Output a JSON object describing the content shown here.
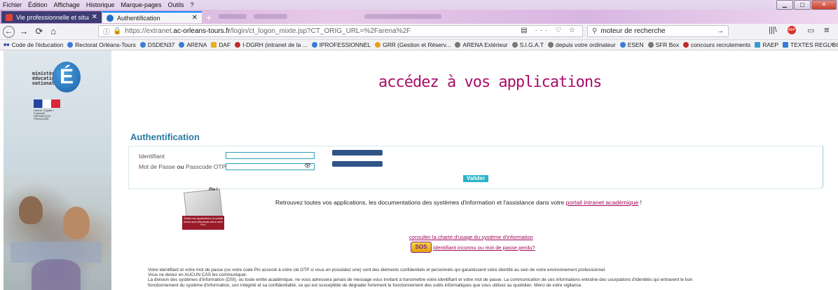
{
  "menubar": {
    "items": [
      "Fichier",
      "Édition",
      "Affichage",
      "Historique",
      "Marque-pages",
      "Outils",
      "?"
    ]
  },
  "window_controls": {
    "minimize": "▁",
    "maximize": "▢",
    "close": "✕"
  },
  "tabs": [
    {
      "label": "Vie professionnelle et situation",
      "close": "✕",
      "favicon_color": "#e2413a"
    },
    {
      "label": "Authentification",
      "close": "✕",
      "favicon_color": "#1f6fc6"
    }
  ],
  "new_tab": "+",
  "navbar": {
    "back": "←",
    "forward": "→",
    "reload": "⟳",
    "home": "⌂",
    "url_prefix": "https://extranet.",
    "url_domain": "ac-orleans-tours.fr",
    "url_path": "/login/ct_logon_mixte.jsp?CT_ORIG_URL=%2Farena%2F",
    "url_actions": "▤ ··· ♡ ☆",
    "search_placeholder": "moteur de recherche",
    "search_go": "→",
    "library": "|||\\",
    "sidebar_toggle": "▭",
    "menu": "≡"
  },
  "bookmarks": [
    {
      "label": "Code de l'éducation",
      "color": "#d42a2a"
    },
    {
      "label": "Rectorat Orléans-Tours",
      "color": "#3a7bd5"
    },
    {
      "label": "DSDEN37",
      "color": "#3a7bd5"
    },
    {
      "label": "ARENA",
      "color": "#3a7bd5"
    },
    {
      "label": "DAF",
      "color": "#e8b020"
    },
    {
      "label": "I-DGRH (intranet de la ...",
      "color": "#c02a2a"
    },
    {
      "label": "IPROFESSIONNEL",
      "color": "#3a7bd5"
    },
    {
      "label": "GRR (Gestion et Réserv...",
      "color": "#e8a020"
    },
    {
      "label": "ARENA Extérieur",
      "color": "#777777"
    },
    {
      "label": "S.I.G.A.T",
      "color": "#777777"
    },
    {
      "label": "depuis votre ordinateur",
      "color": "#777777"
    },
    {
      "label": "ESEN",
      "color": "#3a7bd5"
    },
    {
      "label": "SFR Box",
      "color": "#777777"
    },
    {
      "label": "concours recrutements",
      "color": "#c02a2a"
    },
    {
      "label": "RAEP",
      "color": "#3a9ad5"
    },
    {
      "label": "TEXTES REGL BO ET JO",
      "color": "#3a7bd5"
    }
  ],
  "bookmarks_more": "»",
  "logo": {
    "line1": "ministère",
    "line2": "éducation",
    "line3": "nationale",
    "letter": "É",
    "flag_caption": "Liberté • Égalité • Fraternité RÉPUBLIQUE FRANÇAISE"
  },
  "page": {
    "headline": "accédez à vos applications",
    "auth_title": "Authentification",
    "identifiant_label": "Identifiant",
    "password_label_a": "Mot de Passe ",
    "password_label_or": "ou",
    "password_label_b": " Passcode OTP",
    "eye": "👁",
    "submit": "Valider",
    "pia_top": "Pia !",
    "pia_caption": "Toutes vos applications du portail Arena sont désormais dans votre Pia !",
    "portal_text": "Retrouvez toutes vos applications, les documentations des systèmes d'information et l'assistance dans votre ",
    "portal_link": "portail intranet académique",
    "portal_end": " !",
    "charte_link": "consulter la charte d'usage du système d'information",
    "sos": "SOS",
    "lost_link": "Identifiant inconnu ou mot de passe perdu?",
    "footer": [
      "Votre identifiant et votre mot de passe (ou votre code Pin associé à votre clé OTP si vous en possédez une) sont des éléments confidentiels et personnels qui garantissent votre identité au sein de votre environnement professionnel.",
      "Vous ne devez en AUCUN CAS les communiquer.",
      "La division des systèmes d'information (DSI), ou toute entité académique, ne vous adressera jamais de message vous invitant à transmettre votre identifiant et votre mot de passe. La communication de ces informations entraîne des usurpations d'identités qui entravent le bon",
      "fonctionnement du système d'information, son intégrité et sa confidentialité, ce qui est susceptible de dégrader fortement le fonctionnement des outils informatiques que vous utilisez au quotidien. Merci de votre vigilance."
    ]
  }
}
